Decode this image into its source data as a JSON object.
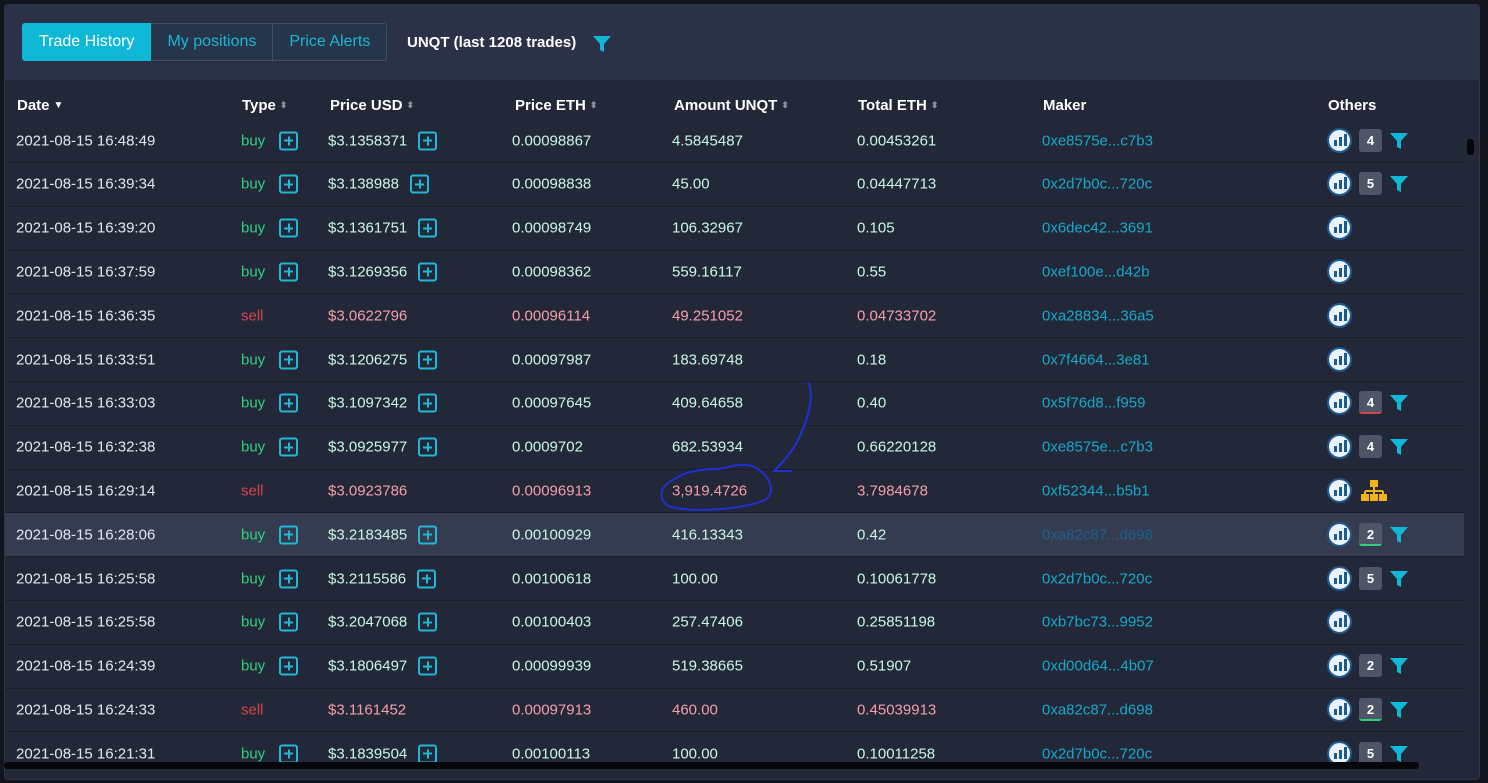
{
  "tabs": [
    {
      "label": "Trade History",
      "active": true
    },
    {
      "label": "My positions",
      "active": false
    },
    {
      "label": "Price Alerts",
      "active": false
    }
  ],
  "token_title": "UNQT (last 1208 trades)",
  "columns": {
    "date": "Date",
    "type": "Type",
    "price_usd": "Price USD",
    "price_eth": "Price ETH",
    "amount": "Amount UNQT",
    "total_eth": "Total ETH",
    "maker": "Maker",
    "others": "Others"
  },
  "rows": [
    {
      "date": "2021-08-15 16:48:49",
      "type": "buy",
      "price_usd": "$3.1358371",
      "price_eth": "0.00098867",
      "amount": "4.5845487",
      "total_eth": "0.00453261",
      "maker": "0xe8575e...c7b3",
      "badge": "4",
      "badge_line": "",
      "filter": true,
      "tree": false
    },
    {
      "date": "2021-08-15 16:39:34",
      "type": "buy",
      "price_usd": "$3.138988",
      "price_eth": "0.00098838",
      "amount": "45.00",
      "total_eth": "0.04447713",
      "maker": "0x2d7b0c...720c",
      "badge": "5",
      "badge_line": "",
      "filter": true,
      "tree": false
    },
    {
      "date": "2021-08-15 16:39:20",
      "type": "buy",
      "price_usd": "$3.1361751",
      "price_eth": "0.00098749",
      "amount": "106.32967",
      "total_eth": "0.105",
      "maker": "0x6dec42...3691",
      "badge": "",
      "badge_line": "",
      "filter": false,
      "tree": false
    },
    {
      "date": "2021-08-15 16:37:59",
      "type": "buy",
      "price_usd": "$3.1269356",
      "price_eth": "0.00098362",
      "amount": "559.16117",
      "total_eth": "0.55",
      "maker": "0xef100e...d42b",
      "badge": "",
      "badge_line": "",
      "filter": false,
      "tree": false
    },
    {
      "date": "2021-08-15 16:36:35",
      "type": "sell",
      "price_usd": "$3.0622796",
      "price_eth": "0.00096114",
      "amount": "49.251052",
      "total_eth": "0.04733702",
      "maker": "0xa28834...36a5",
      "badge": "",
      "badge_line": "",
      "filter": false,
      "tree": false
    },
    {
      "date": "2021-08-15 16:33:51",
      "type": "buy",
      "price_usd": "$3.1206275",
      "price_eth": "0.00097987",
      "amount": "183.69748",
      "total_eth": "0.18",
      "maker": "0x7f4664...3e81",
      "badge": "",
      "badge_line": "",
      "filter": false,
      "tree": false
    },
    {
      "date": "2021-08-15 16:33:03",
      "type": "buy",
      "price_usd": "$3.1097342",
      "price_eth": "0.00097645",
      "amount": "409.64658",
      "total_eth": "0.40",
      "maker": "0x5f76d8...f959",
      "badge": "4",
      "badge_line": "red",
      "filter": true,
      "tree": false
    },
    {
      "date": "2021-08-15 16:32:38",
      "type": "buy",
      "price_usd": "$3.0925977",
      "price_eth": "0.0009702",
      "amount": "682.53934",
      "total_eth": "0.66220128",
      "maker": "0xe8575e...c7b3",
      "badge": "4",
      "badge_line": "",
      "filter": true,
      "tree": false
    },
    {
      "date": "2021-08-15 16:29:14",
      "type": "sell",
      "price_usd": "$3.0923786",
      "price_eth": "0.00096913",
      "amount": "3,919.4726",
      "total_eth": "3.7984678",
      "maker": "0xf52344...b5b1",
      "badge": "",
      "badge_line": "",
      "filter": false,
      "tree": true
    },
    {
      "date": "2021-08-15 16:28:06",
      "type": "buy",
      "price_usd": "$3.2183485",
      "price_eth": "0.00100929",
      "amount": "416.13343",
      "total_eth": "0.42",
      "maker": "0xa82c87...d698",
      "badge": "2",
      "badge_line": "green",
      "filter": true,
      "tree": false,
      "highlight": true
    },
    {
      "date": "2021-08-15 16:25:58",
      "type": "buy",
      "price_usd": "$3.2115586",
      "price_eth": "0.00100618",
      "amount": "100.00",
      "total_eth": "0.10061778",
      "maker": "0x2d7b0c...720c",
      "badge": "5",
      "badge_line": "",
      "filter": true,
      "tree": false
    },
    {
      "date": "2021-08-15 16:25:58",
      "type": "buy",
      "price_usd": "$3.2047068",
      "price_eth": "0.00100403",
      "amount": "257.47406",
      "total_eth": "0.25851198",
      "maker": "0xb7bc73...9952",
      "badge": "",
      "badge_line": "",
      "filter": false,
      "tree": false
    },
    {
      "date": "2021-08-15 16:24:39",
      "type": "buy",
      "price_usd": "$3.1806497",
      "price_eth": "0.00099939",
      "amount": "519.38665",
      "total_eth": "0.51907",
      "maker": "0xd00d64...4b07",
      "badge": "2",
      "badge_line": "",
      "filter": true,
      "tree": false
    },
    {
      "date": "2021-08-15 16:24:33",
      "type": "sell",
      "price_usd": "$3.1161452",
      "price_eth": "0.00097913",
      "amount": "460.00",
      "total_eth": "0.45039913",
      "maker": "0xa82c87...d698",
      "badge": "2",
      "badge_line": "green",
      "filter": true,
      "tree": false
    },
    {
      "date": "2021-08-15 16:21:31",
      "type": "buy",
      "price_usd": "$3.1839504",
      "price_eth": "0.00100113",
      "amount": "100.00",
      "total_eth": "0.10011258",
      "maker": "0x2d7b0c...720c",
      "badge": "5",
      "badge_line": "",
      "filter": true,
      "tree": false
    }
  ],
  "colors": {
    "accent": "#10b8d8",
    "buy": "#2ed180",
    "sell": "#d6424f",
    "annotation": "#1f2fd6",
    "tree_icon": "#f2b21b"
  },
  "icons": {
    "title_filter": "filter-icon",
    "chart_badge": "chart-icon",
    "tree": "sitemap-icon"
  }
}
